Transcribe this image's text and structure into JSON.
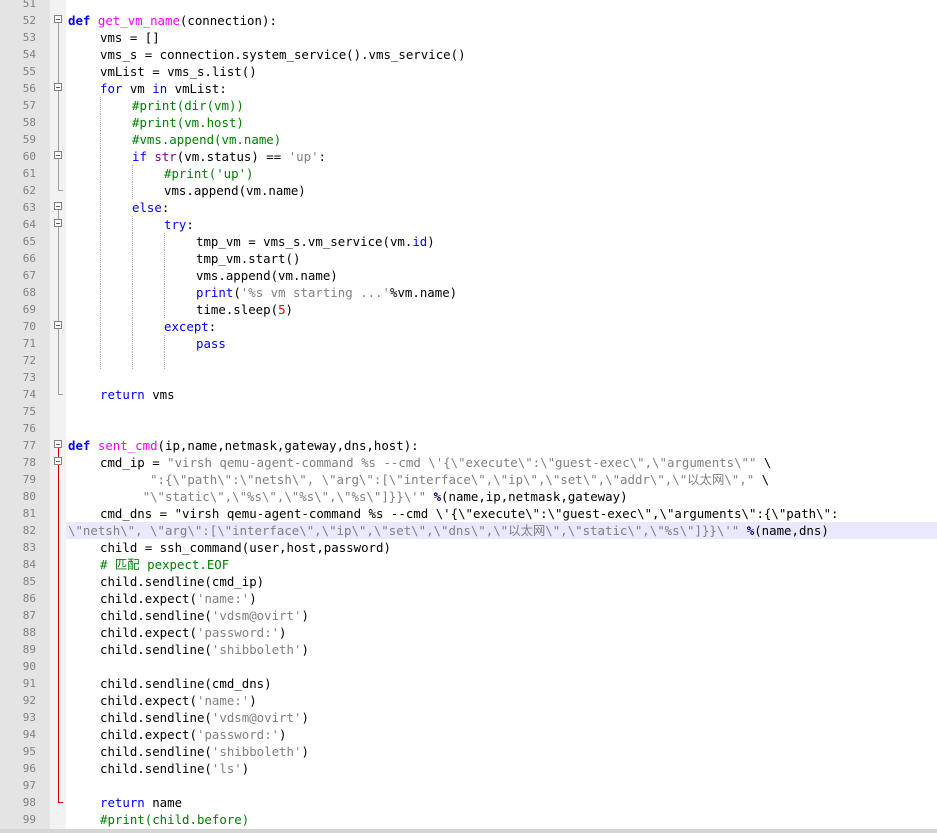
{
  "editor": {
    "language": "Python",
    "current_line": 82,
    "colors": {
      "keyword": "#0000ff",
      "function_name": "#ff00ff",
      "string": "#808080",
      "comment": "#008000",
      "number": "#ff0000",
      "fold_error_marker": "#d00000",
      "current_line_highlight": "#e8e8ff"
    },
    "lines": [
      {
        "n": "51",
        "fold": "none",
        "indent": 0,
        "tokens": []
      },
      {
        "n": "52",
        "fold": "open",
        "indent": 0,
        "tokens": [
          [
            "def",
            "def"
          ],
          [
            "t",
            " "
          ],
          [
            "fn",
            "get_vm_name"
          ],
          [
            "t",
            "(connection):"
          ]
        ]
      },
      {
        "n": "53",
        "fold": "line",
        "indent": 1,
        "tokens": [
          [
            "t",
            "vms = []"
          ]
        ]
      },
      {
        "n": "54",
        "fold": "line",
        "indent": 1,
        "tokens": [
          [
            "t",
            "vms_s = connection.system_service().vms_service()"
          ]
        ]
      },
      {
        "n": "55",
        "fold": "line",
        "indent": 1,
        "tokens": [
          [
            "t",
            "vmList = vms_s.list()"
          ]
        ]
      },
      {
        "n": "56",
        "fold": "open",
        "indent": 1,
        "tokens": [
          [
            "kw",
            "for"
          ],
          [
            "t",
            " vm "
          ],
          [
            "kw",
            "in"
          ],
          [
            "t",
            " vmList:"
          ]
        ]
      },
      {
        "n": "57",
        "fold": "line",
        "indent": 2,
        "tokens": [
          [
            "cm",
            "#print(dir(vm))"
          ]
        ]
      },
      {
        "n": "58",
        "fold": "line",
        "indent": 2,
        "tokens": [
          [
            "cm",
            "#print(vm.host)"
          ]
        ]
      },
      {
        "n": "59",
        "fold": "line",
        "indent": 2,
        "tokens": [
          [
            "cm",
            "#vms.append(vm.name)"
          ]
        ]
      },
      {
        "n": "60",
        "fold": "open",
        "indent": 2,
        "tokens": [
          [
            "kw",
            "if"
          ],
          [
            "t",
            " "
          ],
          [
            "bi",
            "str"
          ],
          [
            "t",
            "(vm.status) == "
          ],
          [
            "str",
            "'up'"
          ],
          [
            "t",
            ":"
          ]
        ]
      },
      {
        "n": "61",
        "fold": "line",
        "indent": 3,
        "tokens": [
          [
            "cm",
            "#print('up')"
          ]
        ]
      },
      {
        "n": "62",
        "fold": "end",
        "indent": 3,
        "tokens": [
          [
            "t",
            "vms.append(vm.name)"
          ]
        ]
      },
      {
        "n": "63",
        "fold": "open",
        "indent": 2,
        "tokens": [
          [
            "kw",
            "else"
          ],
          [
            "t",
            ":"
          ]
        ]
      },
      {
        "n": "64",
        "fold": "open",
        "indent": 3,
        "tokens": [
          [
            "kw",
            "try"
          ],
          [
            "t",
            ":"
          ]
        ]
      },
      {
        "n": "65",
        "fold": "line",
        "indent": 4,
        "tokens": [
          [
            "t",
            "tmp_vm = vms_s.vm_service(vm."
          ],
          [
            "kw",
            "id"
          ],
          [
            "t",
            ")"
          ]
        ]
      },
      {
        "n": "66",
        "fold": "line",
        "indent": 4,
        "tokens": [
          [
            "t",
            "tmp_vm.start()"
          ]
        ]
      },
      {
        "n": "67",
        "fold": "line",
        "indent": 4,
        "tokens": [
          [
            "t",
            "vms.append(vm.name)"
          ]
        ]
      },
      {
        "n": "68",
        "fold": "line",
        "indent": 4,
        "tokens": [
          [
            "kw",
            "print"
          ],
          [
            "t",
            "("
          ],
          [
            "str",
            "'%s vm starting ...'"
          ],
          [
            "t",
            "%vm.name)"
          ]
        ]
      },
      {
        "n": "69",
        "fold": "line",
        "indent": 4,
        "tokens": [
          [
            "t",
            "time.sleep("
          ],
          [
            "num",
            "5"
          ],
          [
            "t",
            ")"
          ]
        ]
      },
      {
        "n": "70",
        "fold": "open",
        "indent": 3,
        "tokens": [
          [
            "kw",
            "except"
          ],
          [
            "t",
            ":"
          ]
        ]
      },
      {
        "n": "71",
        "fold": "line",
        "indent": 4,
        "tokens": [
          [
            "kw",
            "pass"
          ]
        ]
      },
      {
        "n": "72",
        "fold": "line",
        "indent": 0,
        "guides": 3,
        "tokens": []
      },
      {
        "n": "73",
        "fold": "line",
        "indent": 0,
        "tokens": []
      },
      {
        "n": "74",
        "fold": "end",
        "indent": 1,
        "tokens": [
          [
            "kw",
            "return"
          ],
          [
            "t",
            " vms"
          ]
        ]
      },
      {
        "n": "75",
        "fold": "none",
        "indent": 0,
        "tokens": []
      },
      {
        "n": "76",
        "fold": "none",
        "indent": 0,
        "tokens": []
      },
      {
        "n": "77",
        "fold": "open-red",
        "indent": 0,
        "tokens": [
          [
            "def",
            "def"
          ],
          [
            "t",
            " "
          ],
          [
            "fn",
            "sent_cmd"
          ],
          [
            "t",
            "(ip,name,netmask,gateway,dns,host):"
          ]
        ]
      },
      {
        "n": "78",
        "fold": "open-red2",
        "indent": 1,
        "tokens": [
          [
            "t",
            "cmd_ip = "
          ],
          [
            "str",
            "\"virsh qemu-agent-command %s --cmd \\'{\\\"execute\\\":\\\"guest-exec\\\",\\\"arguments\\\"\""
          ],
          [
            "t",
            " \\"
          ]
        ]
      },
      {
        "n": "79",
        "fold": "line-red",
        "indent": 0,
        "tokens": [
          [
            "t",
            "           "
          ],
          [
            "str",
            "\":{\\\"path\\\":\\\"netsh\\\", \\\"arg\\\":[\\\"interface\\\",\\\"ip\\\",\\\"set\\\",\\\"addr\\\",\\\"以太网\\\",\""
          ],
          [
            "t",
            " \\"
          ]
        ]
      },
      {
        "n": "80",
        "fold": "line-red",
        "indent": 0,
        "tokens": [
          [
            "t",
            "          "
          ],
          [
            "str",
            "\"\\\"static\\\",\\\"%s\\\",\\\"%s\\\",\\\"%s\\\"]}}\\'\""
          ],
          [
            "t",
            " "
          ],
          [
            "op",
            "%"
          ],
          [
            "t",
            "(name,ip,netmask,gateway)"
          ]
        ]
      },
      {
        "n": "81",
        "fold": "line-red",
        "indent": 1,
        "tokens": [
          [
            "t",
            "cmd_dns = \"virsh qemu-agent-command %s --cmd \\'{\\\"execute\\\":\\\"guest-exec\\\",\\\"arguments\\\":{\\\"path\\\":"
          ]
        ]
      },
      {
        "n": "82",
        "fold": "line-red",
        "indent": 0,
        "tokens": [
          [
            "str",
            "\\\"netsh\\\", \\\"arg\\\":[\\\"interface\\\",\\\"ip\\\",\\\"set\\\",\\\"dns\\\",\\\"以太网\\\",\\\"static\\\",\\\"%s\\\"]}}\\'\""
          ],
          [
            "t",
            " "
          ],
          [
            "op",
            "%"
          ],
          [
            "t",
            "(name,dns)"
          ]
        ]
      },
      {
        "n": "83",
        "fold": "line-red",
        "indent": 1,
        "tokens": [
          [
            "t",
            "child = ssh_command(user,host,password)"
          ]
        ]
      },
      {
        "n": "84",
        "fold": "line-red",
        "indent": 1,
        "tokens": [
          [
            "cm",
            "# 匹配 pexpect.EOF"
          ]
        ]
      },
      {
        "n": "85",
        "fold": "line-red",
        "indent": 1,
        "tokens": [
          [
            "t",
            "child.sendline(cmd_ip)"
          ]
        ]
      },
      {
        "n": "86",
        "fold": "line-red",
        "indent": 1,
        "tokens": [
          [
            "t",
            "child.expect("
          ],
          [
            "str",
            "'name:'"
          ],
          [
            "t",
            ")"
          ]
        ]
      },
      {
        "n": "87",
        "fold": "line-red",
        "indent": 1,
        "tokens": [
          [
            "t",
            "child.sendline("
          ],
          [
            "str",
            "'vdsm@ovirt'"
          ],
          [
            "t",
            ")"
          ]
        ]
      },
      {
        "n": "88",
        "fold": "line-red",
        "indent": 1,
        "tokens": [
          [
            "t",
            "child.expect("
          ],
          [
            "str",
            "'password:'"
          ],
          [
            "t",
            ")"
          ]
        ]
      },
      {
        "n": "89",
        "fold": "line-red",
        "indent": 1,
        "tokens": [
          [
            "t",
            "child.sendline("
          ],
          [
            "str",
            "'shibboleth'"
          ],
          [
            "t",
            ")"
          ]
        ]
      },
      {
        "n": "90",
        "fold": "line-red",
        "indent": 0,
        "tokens": []
      },
      {
        "n": "91",
        "fold": "line-red",
        "indent": 1,
        "tokens": [
          [
            "t",
            "child.sendline(cmd_dns)"
          ]
        ]
      },
      {
        "n": "92",
        "fold": "line-red",
        "indent": 1,
        "tokens": [
          [
            "t",
            "child.expect("
          ],
          [
            "str",
            "'name:'"
          ],
          [
            "t",
            ")"
          ]
        ]
      },
      {
        "n": "93",
        "fold": "line-red",
        "indent": 1,
        "tokens": [
          [
            "t",
            "child.sendline("
          ],
          [
            "str",
            "'vdsm@ovirt'"
          ],
          [
            "t",
            ")"
          ]
        ]
      },
      {
        "n": "94",
        "fold": "line-red",
        "indent": 1,
        "tokens": [
          [
            "t",
            "child.expect("
          ],
          [
            "str",
            "'password:'"
          ],
          [
            "t",
            ")"
          ]
        ]
      },
      {
        "n": "95",
        "fold": "line-red",
        "indent": 1,
        "tokens": [
          [
            "t",
            "child.sendline("
          ],
          [
            "str",
            "'shibboleth'"
          ],
          [
            "t",
            ")"
          ]
        ]
      },
      {
        "n": "96",
        "fold": "line-red",
        "indent": 1,
        "tokens": [
          [
            "t",
            "child.sendline("
          ],
          [
            "str",
            "'ls'"
          ],
          [
            "t",
            ")"
          ]
        ]
      },
      {
        "n": "97",
        "fold": "line-red",
        "indent": 0,
        "tokens": []
      },
      {
        "n": "98",
        "fold": "end-red",
        "indent": 1,
        "tokens": [
          [
            "kw",
            "return"
          ],
          [
            "t",
            " name"
          ]
        ]
      },
      {
        "n": "99",
        "fold": "none",
        "indent": 1,
        "tokens": [
          [
            "cm",
            "#print(child.before)"
          ]
        ]
      }
    ]
  }
}
